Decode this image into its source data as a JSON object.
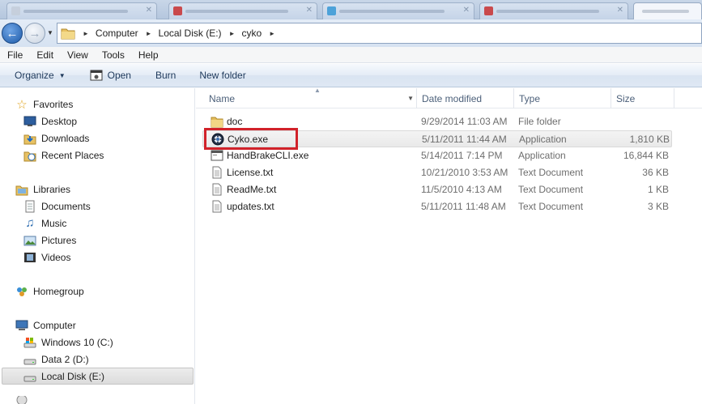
{
  "address": {
    "breadcrumbs": [
      "Computer",
      "Local Disk (E:)",
      "cyko"
    ]
  },
  "menu": [
    "File",
    "Edit",
    "View",
    "Tools",
    "Help"
  ],
  "toolbar": {
    "organize": "Organize",
    "open": "Open",
    "burn": "Burn",
    "new_folder": "New folder"
  },
  "nav": {
    "favorites": "Favorites",
    "desktop": "Desktop",
    "downloads": "Downloads",
    "recent_places": "Recent Places",
    "libraries": "Libraries",
    "documents": "Documents",
    "music": "Music",
    "pictures": "Pictures",
    "videos": "Videos",
    "homegroup": "Homegroup",
    "computer": "Computer",
    "drive_c": "Windows 10 (C:)",
    "drive_d": "Data 2 (D:)",
    "drive_e": "Local Disk (E:)"
  },
  "columns": {
    "name": "Name",
    "date": "Date modified",
    "type": "Type",
    "size": "Size"
  },
  "files": [
    {
      "name": "doc",
      "date": "9/29/2014 11:03 AM",
      "type": "File folder",
      "size": "",
      "icon": "folder-icon"
    },
    {
      "name": "Cyko.exe",
      "date": "5/11/2011 11:44 AM",
      "type": "Application",
      "size": "1,810 KB",
      "icon": "cyko-app-icon"
    },
    {
      "name": "HandBrakeCLI.exe",
      "date": "5/14/2011 7:14 PM",
      "type": "Application",
      "size": "16,844 KB",
      "icon": "console-app-icon"
    },
    {
      "name": "License.txt",
      "date": "10/21/2010 3:53 AM",
      "type": "Text Document",
      "size": "36 KB",
      "icon": "text-file-icon"
    },
    {
      "name": "ReadMe.txt",
      "date": "11/5/2010 4:13 AM",
      "type": "Text Document",
      "size": "1 KB",
      "icon": "text-file-icon"
    },
    {
      "name": "updates.txt",
      "date": "5/11/2011 11:48 AM",
      "type": "Text Document",
      "size": "3 KB",
      "icon": "text-file-icon"
    }
  ],
  "colors": {
    "highlight_box": "#d1222a",
    "command_text": "#1e395b"
  }
}
